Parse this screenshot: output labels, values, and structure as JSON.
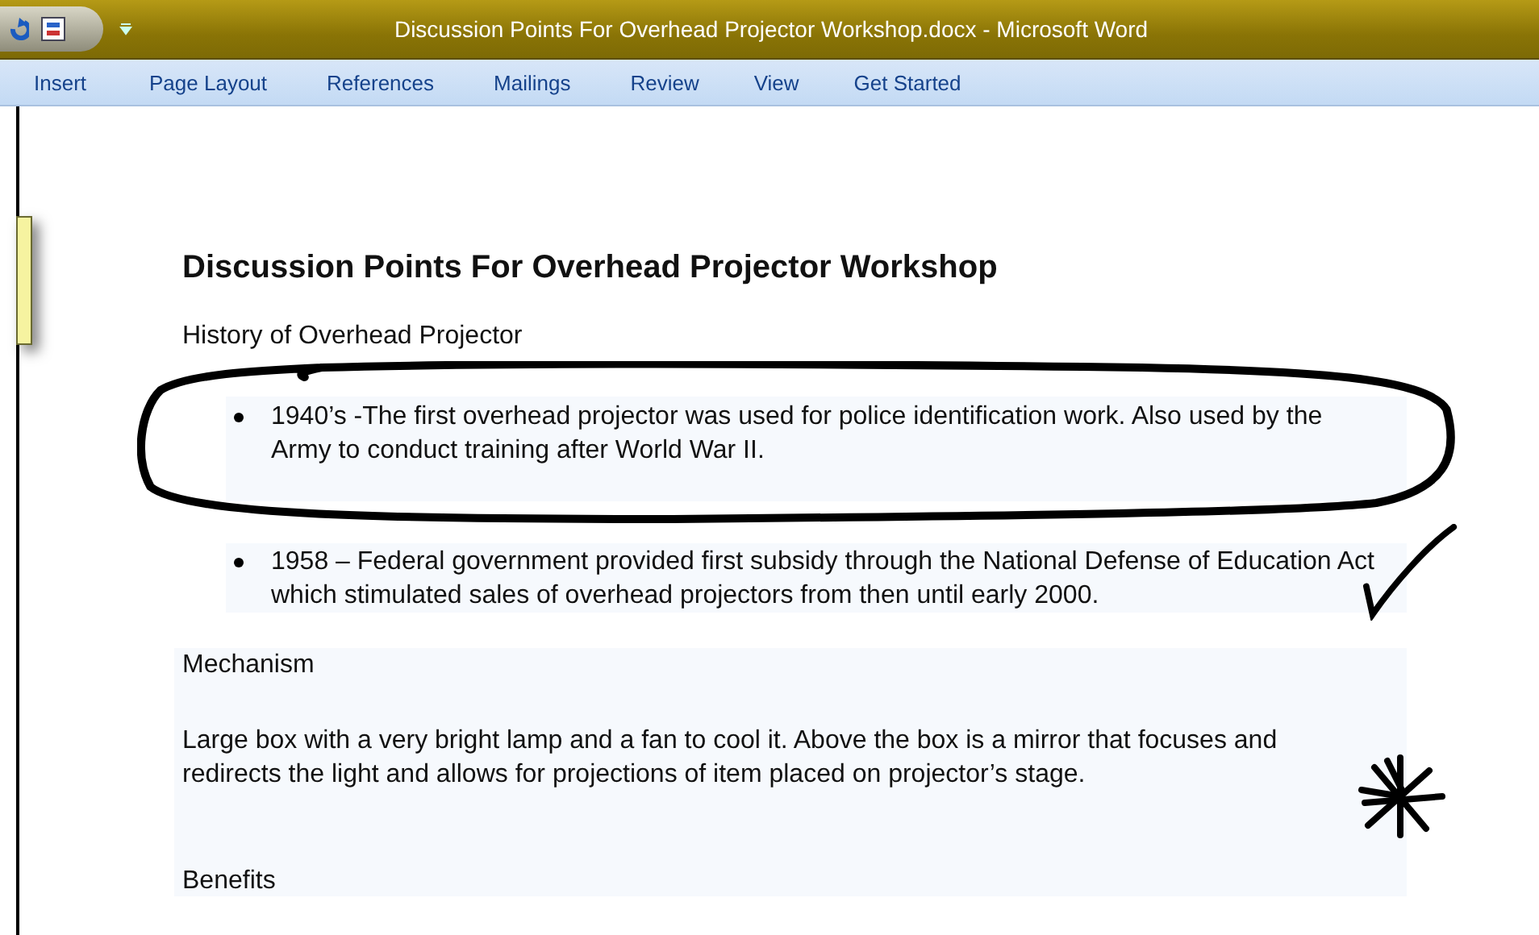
{
  "window": {
    "title": "Discussion Points For Overhead Projector Workshop.docx - Microsoft Word"
  },
  "ribbon_tabs": [
    {
      "label": "Insert",
      "selected": false
    },
    {
      "label": "Page Layout",
      "selected": false
    },
    {
      "label": "References",
      "selected": false
    },
    {
      "label": "Mailings",
      "selected": false
    },
    {
      "label": "Review",
      "selected": false
    },
    {
      "label": "View",
      "selected": false
    },
    {
      "label": "Get Started",
      "selected": false
    }
  ],
  "document": {
    "heading": "Discussion Points For Overhead Projector Workshop",
    "blocks": [
      {
        "kind": "paragraph",
        "text": "History of Overhead Projector"
      },
      {
        "kind": "bullet",
        "text": "1940’s -The first overhead projector was used for police identification work. Also used by the Army to conduct training after World  War II.",
        "ink": {
          "kind": "circle"
        }
      },
      {
        "kind": "bullet",
        "text": "1958 – Federal government provided first subsidy through the National Defense of Education Act which stimulated sales of overhead projectors from then until early 2000.",
        "ink": {
          "kind": "check"
        }
      },
      {
        "kind": "section",
        "title": "Mechanism",
        "text": "Large box with a very bright lamp and a fan to cool it.  Above the box is a mirror that focuses and redirects the light and allows for projections of item placed on projector’s stage.",
        "ink": {
          "kind": "asterisk"
        }
      },
      {
        "kind": "section-title",
        "text": "Benefits"
      }
    ]
  }
}
